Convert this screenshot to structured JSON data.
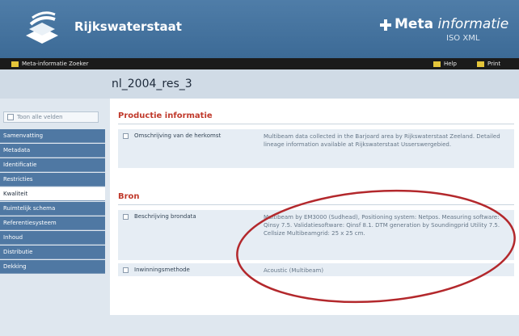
{
  "header": {
    "brand": "Rijkswaterstaat",
    "meta_bold": "Meta",
    "meta_italic": "informatie",
    "meta_sub": "ISO XML"
  },
  "toolbar": {
    "zoeker": "Meta-informatie Zoeker",
    "help": "Help",
    "print": "Print"
  },
  "document": {
    "title": "nl_2004_res_3"
  },
  "sidebar": {
    "toggle_label": "Toon alle velden",
    "items": [
      {
        "label": "Samenvatting"
      },
      {
        "label": "Metadata"
      },
      {
        "label": "Identificatie"
      },
      {
        "label": "Restricties"
      },
      {
        "label": "Kwaliteit"
      },
      {
        "label": "Ruimtelijk schema"
      },
      {
        "label": "Referentiesysteem"
      },
      {
        "label": "Inhoud"
      },
      {
        "label": "Distributie"
      },
      {
        "label": "Dekking"
      }
    ],
    "active_index": 4
  },
  "sections": {
    "productie": {
      "heading": "Productie informatie",
      "rows": [
        {
          "label": "Omschrijving van de herkomst",
          "value": "Multibeam data collected in the Barjoard area by Rijkswaterstaat Zeeland. Detailed lineage information available at Rijkswaterstaat Usserswergebied."
        }
      ]
    },
    "bron": {
      "heading": "Bron",
      "rows": [
        {
          "label": "Beschrijving brondata",
          "value": "Multibeam by EM3000 (Sudhead), Positioning system: Netpos. Measuring software: Qinsy 7.5. Validatiesoftware: Qinsf 8.1. DTM generation by Soundingprid Utility 7.5. Cellsize Multibeamgrid: 25 x 25 cm."
        },
        {
          "label": "Inwinningsmethode",
          "value": "Acoustic (Multibeam)"
        }
      ]
    }
  },
  "colors": {
    "header_blue": "#4f7da8",
    "nav_blue": "#4f78a3",
    "heading_red": "#c0392b",
    "annotation_red": "#b3282c"
  }
}
